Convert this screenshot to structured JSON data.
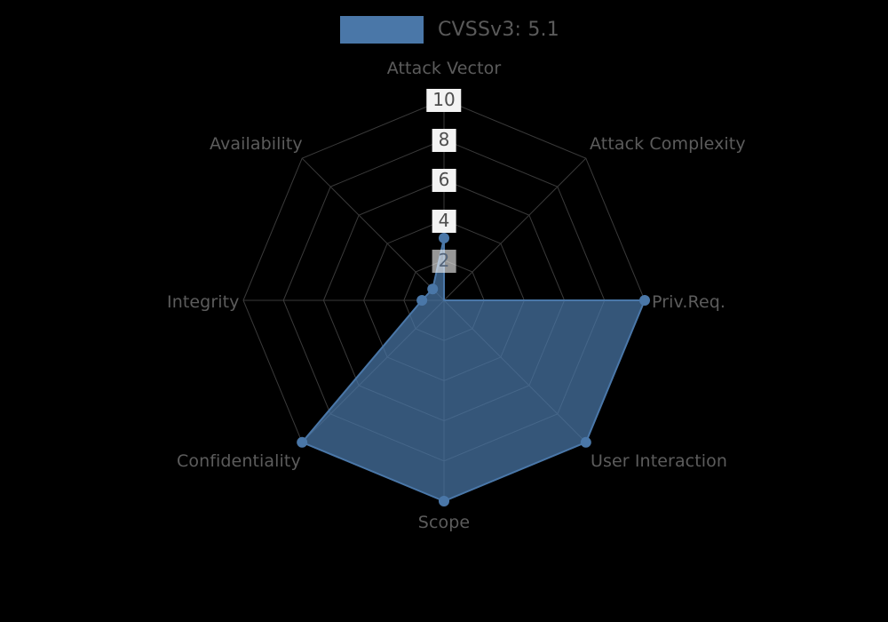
{
  "background_color": "#000000",
  "legend": {
    "position": "top-center",
    "swatch_color": "#4a77a8",
    "label": "CVSSv3: 5.1"
  },
  "chart_data": {
    "type": "radar",
    "title": "CVSSv3: 5.1",
    "xlabel": "",
    "ylabel": "",
    "grid": true,
    "legend_position": "top-center",
    "rlim": [
      0,
      10
    ],
    "r_ticks": [
      2,
      4,
      6,
      8,
      10
    ],
    "r_tick_labels": [
      "2",
      "4",
      "6",
      "8",
      "10"
    ],
    "categories": [
      "Attack Vector",
      "Attack Complexity",
      "Priv.Req.",
      "User Interaction",
      "Scope",
      "Confidentiality",
      "Integrity",
      "Availability"
    ],
    "series": [
      {
        "name": "CVSSv3: 5.1",
        "color": "#4a77a8",
        "fill_opacity": 0.72,
        "values": [
          3.1,
          0.0,
          10.0,
          10.0,
          10.0,
          10.0,
          1.1,
          0.8
        ]
      }
    ],
    "annotations": []
  },
  "axis_labels": {
    "attack_vector": "Attack Vector",
    "attack_complexity": "Attack Complexity",
    "priv_req": "Priv.Req.",
    "user_interaction": "User Interaction",
    "scope": "Scope",
    "confidentiality": "Confidentiality",
    "integrity": "Integrity",
    "availability": "Availability"
  },
  "tick_labels": {
    "t10": "10",
    "t8": "8",
    "t6": "6",
    "t4": "4",
    "t2": "2"
  }
}
